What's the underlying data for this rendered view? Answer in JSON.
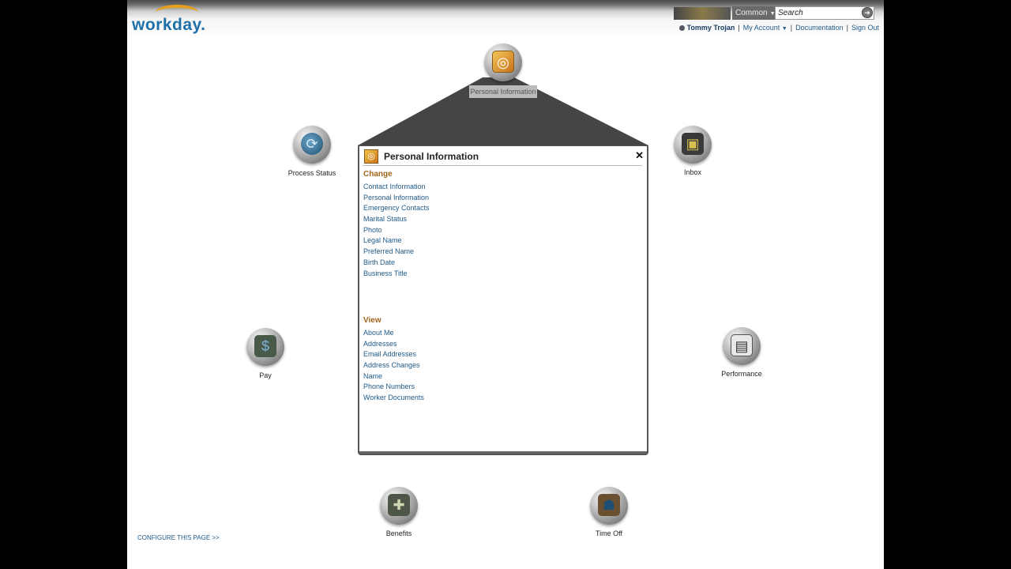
{
  "app": {
    "logo_text": "workday."
  },
  "search": {
    "category": "Common",
    "placeholder": "Search"
  },
  "usernav": {
    "user": "Tommy Trojan",
    "my_account": "My Account",
    "documentation": "Documentation",
    "sign_out": "Sign Out"
  },
  "hubs": {
    "personal_info": {
      "label": "Personal Information",
      "icon": "fingerprint-icon"
    },
    "process_status": {
      "label": "Process Status",
      "icon": "globe-icon"
    },
    "inbox": {
      "label": "Inbox",
      "icon": "inbox-tray-icon"
    },
    "pay": {
      "label": "Pay",
      "icon": "money-icon"
    },
    "performance": {
      "label": "Performance",
      "icon": "clipboard-icon"
    },
    "benefits": {
      "label": "Benefits",
      "icon": "medical-kit-icon"
    },
    "time_off": {
      "label": "Time Off",
      "icon": "desk-worker-icon"
    }
  },
  "popup": {
    "title": "Personal Information",
    "change_title": "Change",
    "change_links": [
      "Contact Information",
      "Personal Information",
      "Emergency Contacts",
      "Marital Status",
      "Photo",
      "Legal Name",
      "Preferred Name",
      "Birth Date",
      "Business Title"
    ],
    "view_title": "View",
    "view_links": [
      "About Me",
      "Addresses",
      "Email Addresses",
      "Address Changes",
      "Name",
      "Phone Numbers",
      "Worker Documents"
    ]
  },
  "footer": {
    "configure": "CONFIGURE THIS PAGE >>"
  }
}
